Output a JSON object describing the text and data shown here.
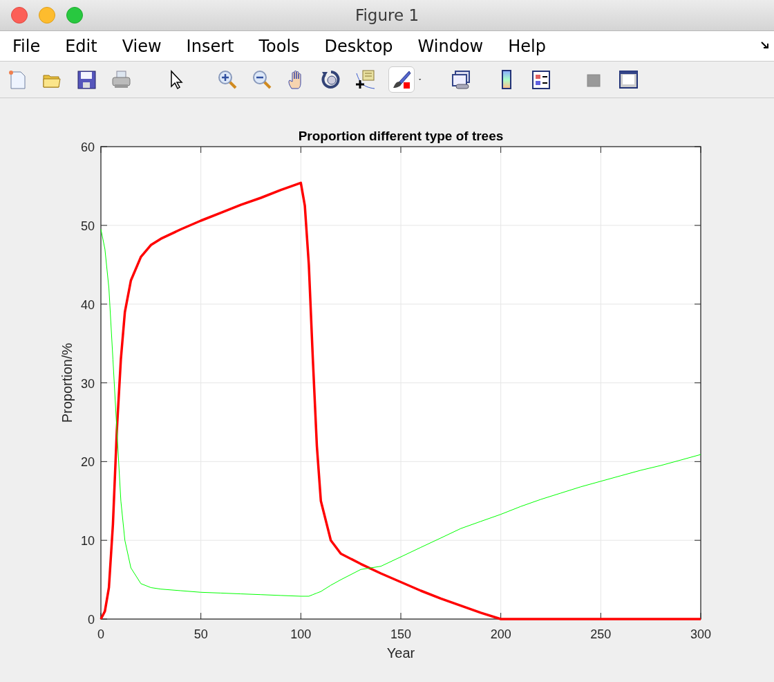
{
  "window": {
    "title": "Figure 1"
  },
  "menu": [
    {
      "label": "File"
    },
    {
      "label": "Edit"
    },
    {
      "label": "View"
    },
    {
      "label": "Insert"
    },
    {
      "label": "Tools"
    },
    {
      "label": "Desktop"
    },
    {
      "label": "Window"
    },
    {
      "label": "Help"
    }
  ],
  "axes": {
    "chart_data": {
      "type": "line",
      "title": "Proportion different type of trees",
      "xlabel": "Year",
      "ylabel": "Proportion/%",
      "x": [
        0,
        2,
        4,
        6,
        8,
        10,
        12,
        15,
        20,
        25,
        30,
        40,
        50,
        60,
        70,
        80,
        90,
        100,
        102,
        104,
        106,
        108,
        110,
        115,
        120,
        130,
        140,
        150,
        160,
        170,
        180,
        190,
        200,
        210,
        220,
        230,
        240,
        250,
        260,
        270,
        280,
        290,
        300
      ],
      "series": [
        {
          "color": "#ff0000",
          "values": [
            0,
            1,
            4,
            12,
            24,
            33,
            39,
            43,
            46,
            47.5,
            48.3,
            49.5,
            50.6,
            51.6,
            52.6,
            53.5,
            54.5,
            55.4,
            52.5,
            45,
            33,
            22,
            15,
            10,
            8.3,
            7,
            5.8,
            4.7,
            3.6,
            2.6,
            1.7,
            0.8,
            0,
            0,
            0,
            0,
            0,
            0,
            0,
            0,
            0,
            0,
            0
          ]
        },
        {
          "color": "#00ff00",
          "values": [
            49.5,
            47,
            42,
            33,
            24,
            15,
            10,
            6.5,
            4.5,
            4,
            3.8,
            3.6,
            3.4,
            3.3,
            3.2,
            3.1,
            3,
            2.9,
            2.9,
            2.9,
            3.1,
            3.3,
            3.5,
            4.3,
            5,
            6.3,
            6.7,
            7.9,
            9.1,
            10.3,
            11.5,
            12.4,
            13.3,
            14.3,
            15.2,
            16,
            16.8,
            17.5,
            18.2,
            18.9,
            19.5,
            20.2,
            20.9
          ]
        }
      ],
      "grid": true,
      "xlim": [
        0,
        300
      ],
      "ylim": [
        0,
        60
      ],
      "xticks": [
        0,
        50,
        100,
        150,
        200,
        250,
        300
      ],
      "yticks": [
        0,
        10,
        20,
        30,
        40,
        50,
        60
      ]
    }
  }
}
